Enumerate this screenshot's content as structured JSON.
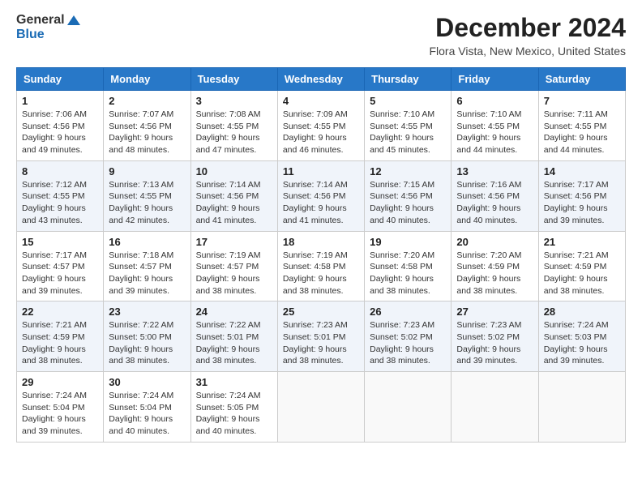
{
  "header": {
    "logo_line1": "General",
    "logo_line2": "Blue",
    "month_title": "December 2024",
    "location": "Flora Vista, New Mexico, United States"
  },
  "weekdays": [
    "Sunday",
    "Monday",
    "Tuesday",
    "Wednesday",
    "Thursday",
    "Friday",
    "Saturday"
  ],
  "weeks": [
    [
      {
        "day": "1",
        "info": "Sunrise: 7:06 AM\nSunset: 4:56 PM\nDaylight: 9 hours\nand 49 minutes."
      },
      {
        "day": "2",
        "info": "Sunrise: 7:07 AM\nSunset: 4:56 PM\nDaylight: 9 hours\nand 48 minutes."
      },
      {
        "day": "3",
        "info": "Sunrise: 7:08 AM\nSunset: 4:55 PM\nDaylight: 9 hours\nand 47 minutes."
      },
      {
        "day": "4",
        "info": "Sunrise: 7:09 AM\nSunset: 4:55 PM\nDaylight: 9 hours\nand 46 minutes."
      },
      {
        "day": "5",
        "info": "Sunrise: 7:10 AM\nSunset: 4:55 PM\nDaylight: 9 hours\nand 45 minutes."
      },
      {
        "day": "6",
        "info": "Sunrise: 7:10 AM\nSunset: 4:55 PM\nDaylight: 9 hours\nand 44 minutes."
      },
      {
        "day": "7",
        "info": "Sunrise: 7:11 AM\nSunset: 4:55 PM\nDaylight: 9 hours\nand 44 minutes."
      }
    ],
    [
      {
        "day": "8",
        "info": "Sunrise: 7:12 AM\nSunset: 4:55 PM\nDaylight: 9 hours\nand 43 minutes."
      },
      {
        "day": "9",
        "info": "Sunrise: 7:13 AM\nSunset: 4:55 PM\nDaylight: 9 hours\nand 42 minutes."
      },
      {
        "day": "10",
        "info": "Sunrise: 7:14 AM\nSunset: 4:56 PM\nDaylight: 9 hours\nand 41 minutes."
      },
      {
        "day": "11",
        "info": "Sunrise: 7:14 AM\nSunset: 4:56 PM\nDaylight: 9 hours\nand 41 minutes."
      },
      {
        "day": "12",
        "info": "Sunrise: 7:15 AM\nSunset: 4:56 PM\nDaylight: 9 hours\nand 40 minutes."
      },
      {
        "day": "13",
        "info": "Sunrise: 7:16 AM\nSunset: 4:56 PM\nDaylight: 9 hours\nand 40 minutes."
      },
      {
        "day": "14",
        "info": "Sunrise: 7:17 AM\nSunset: 4:56 PM\nDaylight: 9 hours\nand 39 minutes."
      }
    ],
    [
      {
        "day": "15",
        "info": "Sunrise: 7:17 AM\nSunset: 4:57 PM\nDaylight: 9 hours\nand 39 minutes."
      },
      {
        "day": "16",
        "info": "Sunrise: 7:18 AM\nSunset: 4:57 PM\nDaylight: 9 hours\nand 39 minutes."
      },
      {
        "day": "17",
        "info": "Sunrise: 7:19 AM\nSunset: 4:57 PM\nDaylight: 9 hours\nand 38 minutes."
      },
      {
        "day": "18",
        "info": "Sunrise: 7:19 AM\nSunset: 4:58 PM\nDaylight: 9 hours\nand 38 minutes."
      },
      {
        "day": "19",
        "info": "Sunrise: 7:20 AM\nSunset: 4:58 PM\nDaylight: 9 hours\nand 38 minutes."
      },
      {
        "day": "20",
        "info": "Sunrise: 7:20 AM\nSunset: 4:59 PM\nDaylight: 9 hours\nand 38 minutes."
      },
      {
        "day": "21",
        "info": "Sunrise: 7:21 AM\nSunset: 4:59 PM\nDaylight: 9 hours\nand 38 minutes."
      }
    ],
    [
      {
        "day": "22",
        "info": "Sunrise: 7:21 AM\nSunset: 4:59 PM\nDaylight: 9 hours\nand 38 minutes."
      },
      {
        "day": "23",
        "info": "Sunrise: 7:22 AM\nSunset: 5:00 PM\nDaylight: 9 hours\nand 38 minutes."
      },
      {
        "day": "24",
        "info": "Sunrise: 7:22 AM\nSunset: 5:01 PM\nDaylight: 9 hours\nand 38 minutes."
      },
      {
        "day": "25",
        "info": "Sunrise: 7:23 AM\nSunset: 5:01 PM\nDaylight: 9 hours\nand 38 minutes."
      },
      {
        "day": "26",
        "info": "Sunrise: 7:23 AM\nSunset: 5:02 PM\nDaylight: 9 hours\nand 38 minutes."
      },
      {
        "day": "27",
        "info": "Sunrise: 7:23 AM\nSunset: 5:02 PM\nDaylight: 9 hours\nand 39 minutes."
      },
      {
        "day": "28",
        "info": "Sunrise: 7:24 AM\nSunset: 5:03 PM\nDaylight: 9 hours\nand 39 minutes."
      }
    ],
    [
      {
        "day": "29",
        "info": "Sunrise: 7:24 AM\nSunset: 5:04 PM\nDaylight: 9 hours\nand 39 minutes."
      },
      {
        "day": "30",
        "info": "Sunrise: 7:24 AM\nSunset: 5:04 PM\nDaylight: 9 hours\nand 40 minutes."
      },
      {
        "day": "31",
        "info": "Sunrise: 7:24 AM\nSunset: 5:05 PM\nDaylight: 9 hours\nand 40 minutes."
      },
      null,
      null,
      null,
      null
    ]
  ]
}
